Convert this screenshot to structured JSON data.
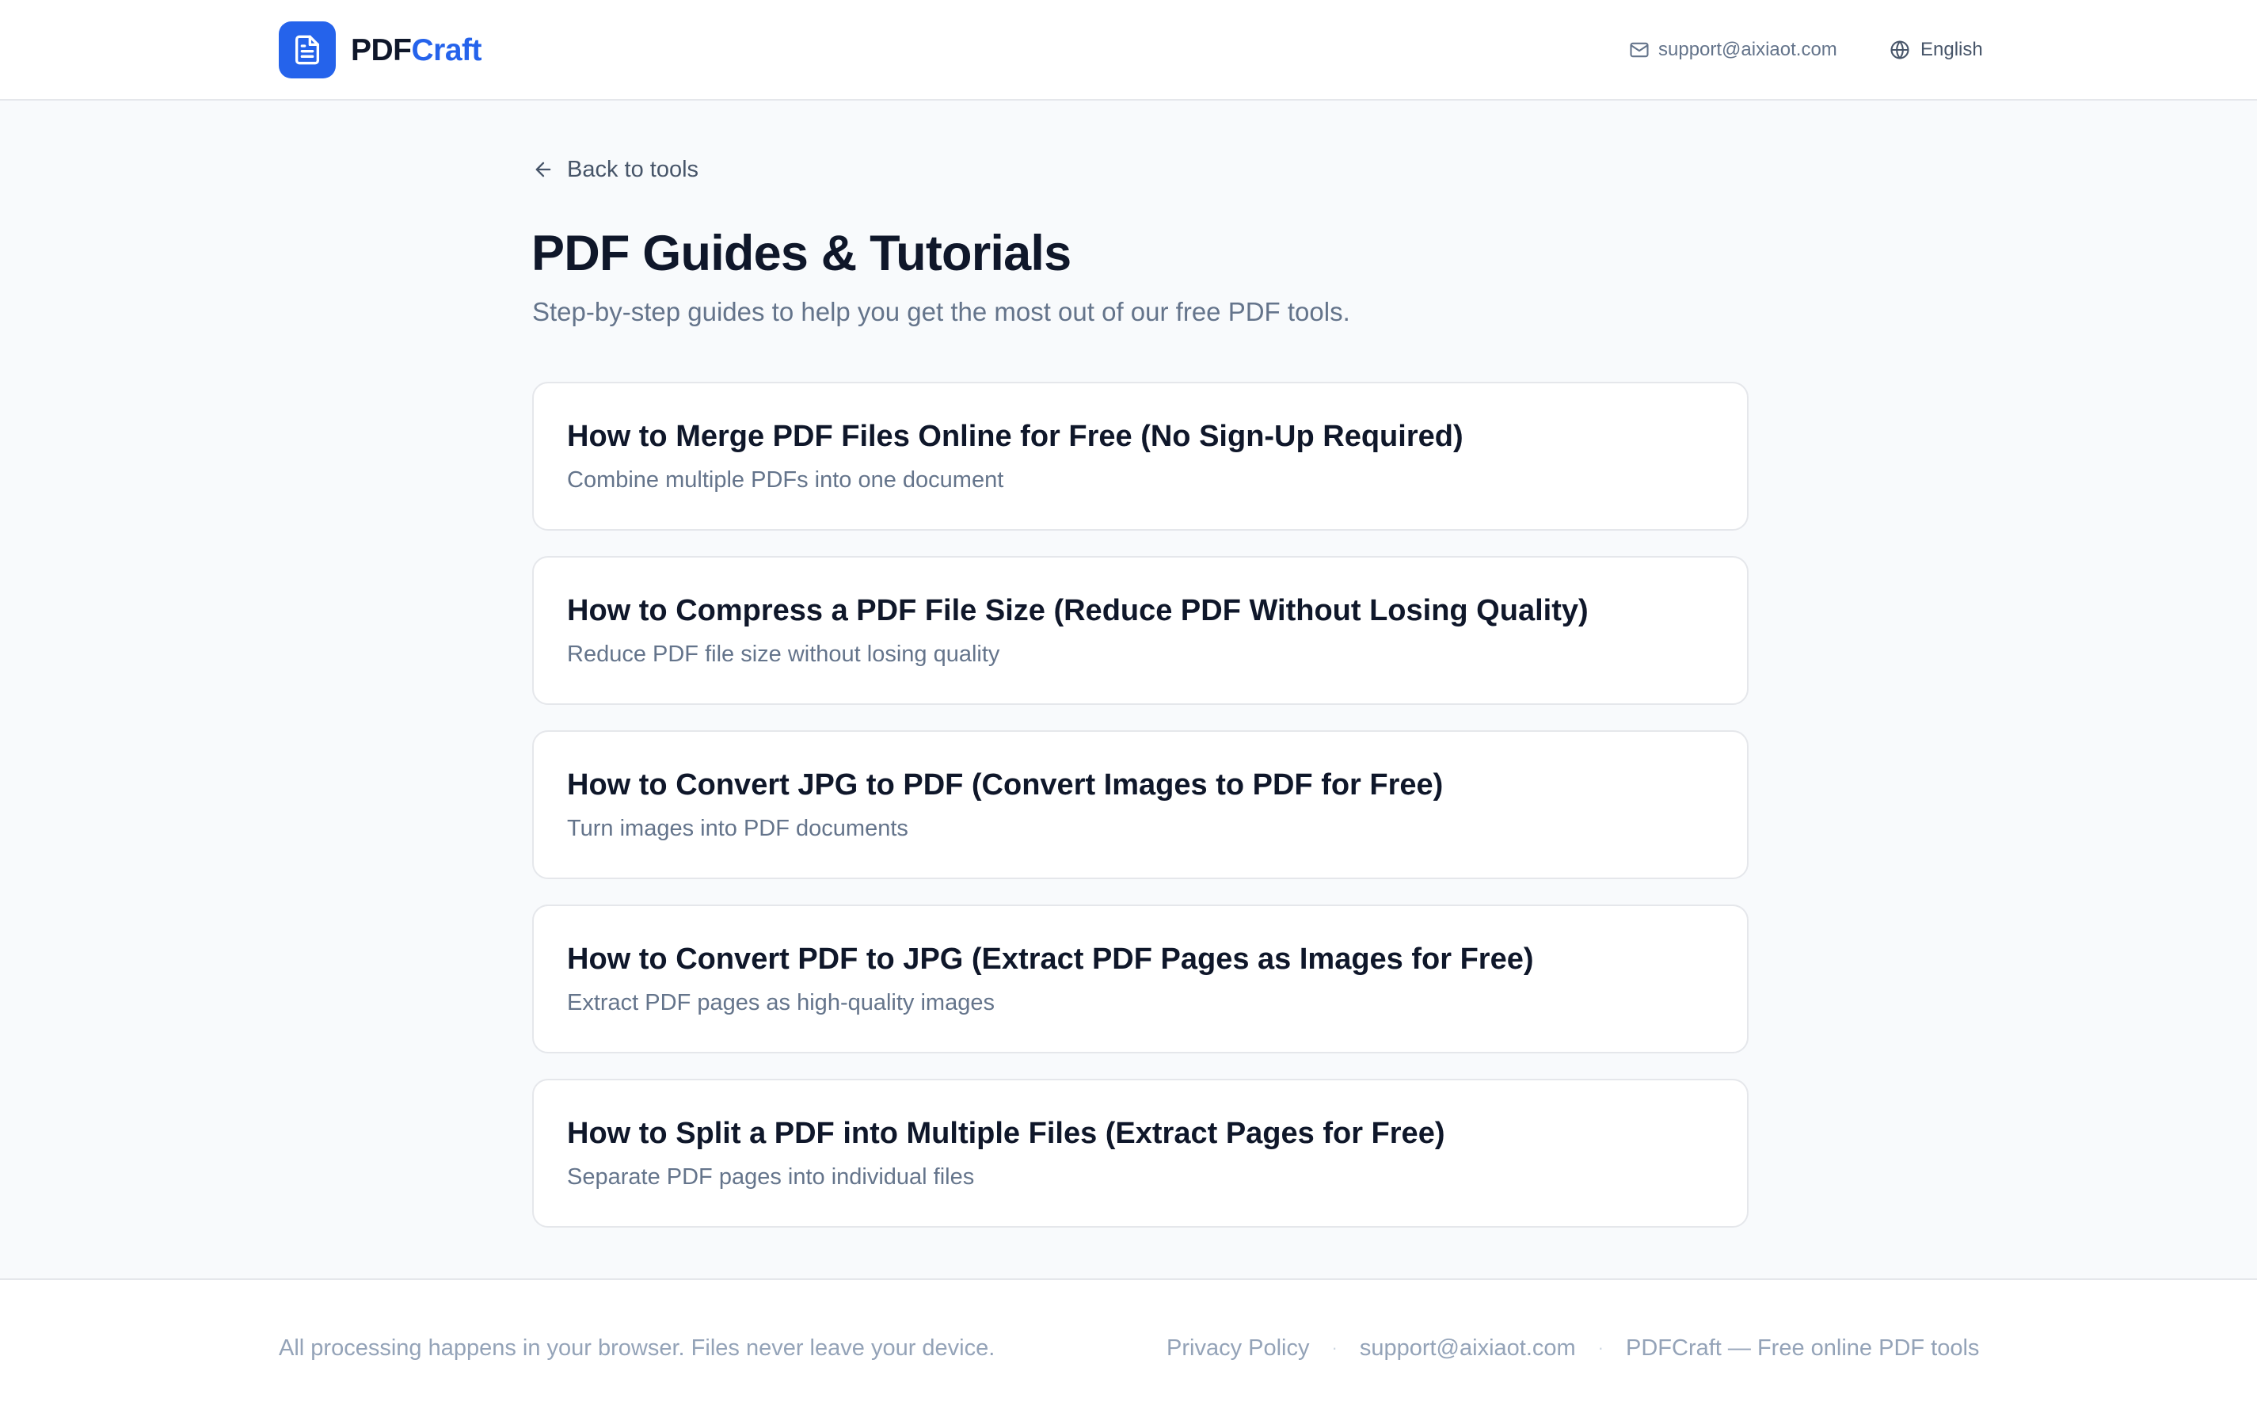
{
  "header": {
    "logo_part1": "PDF",
    "logo_part2": "Craft",
    "email": "support@aixiaot.com",
    "language": "English"
  },
  "main": {
    "back_label": "Back to tools",
    "title": "PDF Guides & Tutorials",
    "subtitle": "Step-by-step guides to help you get the most out of our free PDF tools.",
    "guides": [
      {
        "title": "How to Merge PDF Files Online for Free (No Sign-Up Required)",
        "description": "Combine multiple PDFs into one document"
      },
      {
        "title": "How to Compress a PDF File Size (Reduce PDF Without Losing Quality)",
        "description": "Reduce PDF file size without losing quality"
      },
      {
        "title": "How to Convert JPG to PDF (Convert Images to PDF for Free)",
        "description": "Turn images into PDF documents"
      },
      {
        "title": "How to Convert PDF to JPG (Extract PDF Pages as Images for Free)",
        "description": "Extract PDF pages as high-quality images"
      },
      {
        "title": "How to Split a PDF into Multiple Files (Extract Pages for Free)",
        "description": "Separate PDF pages into individual files"
      }
    ]
  },
  "footer": {
    "note": "All processing happens in your browser. Files never leave your device.",
    "privacy_label": "Privacy Policy",
    "separator": "·",
    "email": "support@aixiaot.com",
    "tagline": "PDFCraft — Free online PDF tools"
  },
  "colors": {
    "brand_blue": "#2563eb",
    "page_background": "#f8fafc",
    "heading": "#0f172a",
    "muted_text": "#64748b",
    "border": "#e5e7eb"
  }
}
